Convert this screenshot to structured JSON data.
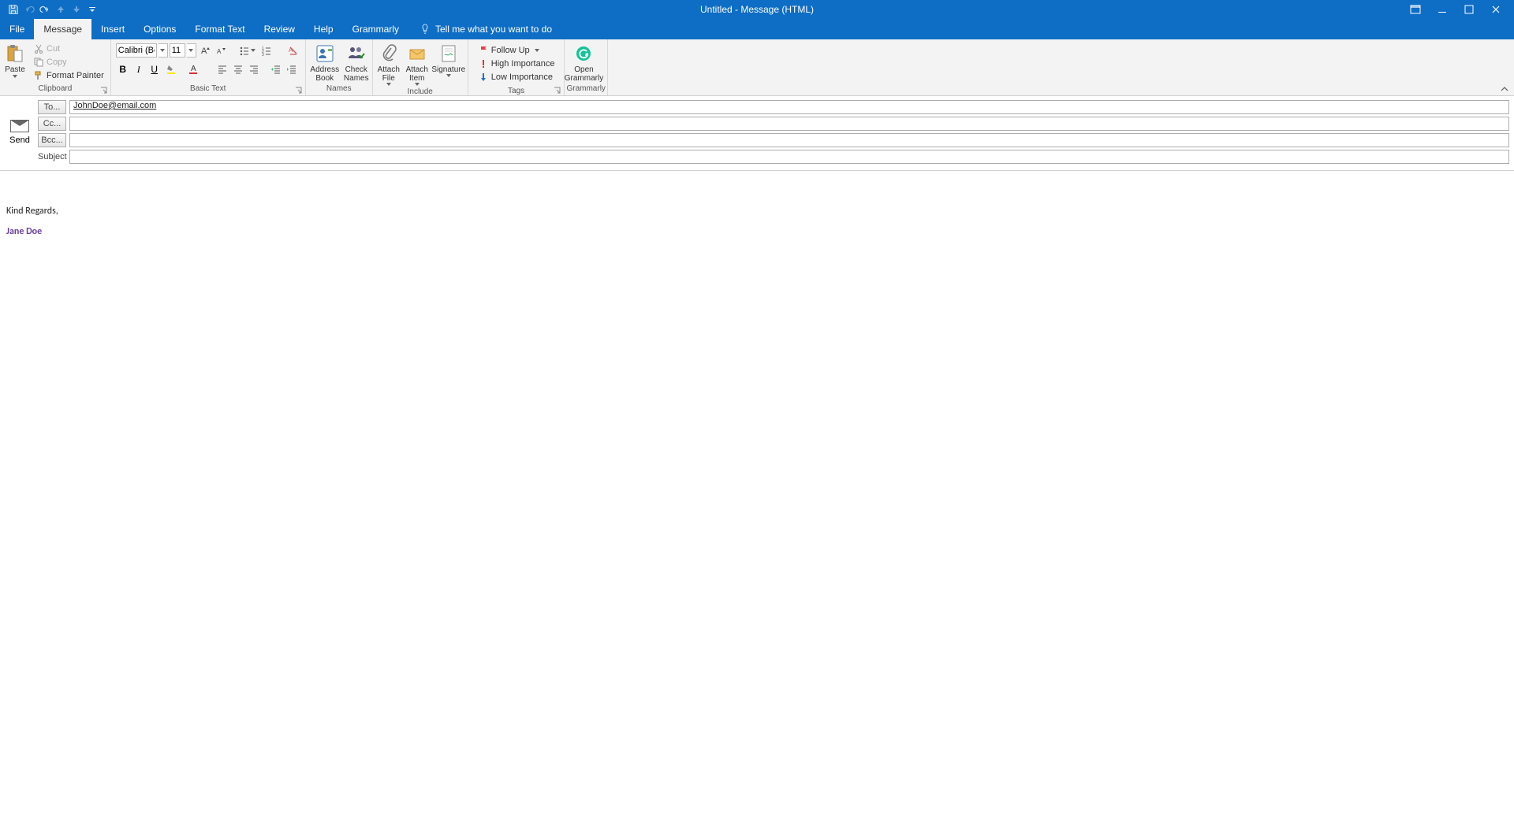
{
  "window": {
    "title": "Untitled  -  Message (HTML)"
  },
  "tabs": {
    "file": "File",
    "message": "Message",
    "insert": "Insert",
    "options": "Options",
    "format_text": "Format Text",
    "review": "Review",
    "help": "Help",
    "grammarly": "Grammarly",
    "tell_me": "Tell me what you want to do"
  },
  "ribbon": {
    "clipboard": {
      "label": "Clipboard",
      "paste": "Paste",
      "cut": "Cut",
      "copy": "Copy",
      "format_painter": "Format Painter"
    },
    "basic_text": {
      "label": "Basic Text",
      "font_name": "Calibri (Body)",
      "font_size": "11"
    },
    "names": {
      "label": "Names",
      "address_book": "Address Book",
      "check_names": "Check Names"
    },
    "include": {
      "label": "Include",
      "attach_file": "Attach File",
      "attach_item": "Attach Item",
      "signature": "Signature"
    },
    "tags": {
      "label": "Tags",
      "follow_up": "Follow Up",
      "high_importance": "High Importance",
      "low_importance": "Low Importance"
    },
    "grammarly_group": {
      "label": "Grammarly",
      "open_grammarly": "Open Grammarly"
    }
  },
  "compose": {
    "send": "Send",
    "to_label": "To...",
    "cc_label": "Cc...",
    "bcc_label": "Bcc...",
    "subject_label": "Subject",
    "to_value": "JohnDoe@email.com",
    "cc_value": "",
    "bcc_value": "",
    "subject_value": ""
  },
  "body": {
    "line1": "Kind Regards,",
    "signature_name": "Jane Doe"
  }
}
